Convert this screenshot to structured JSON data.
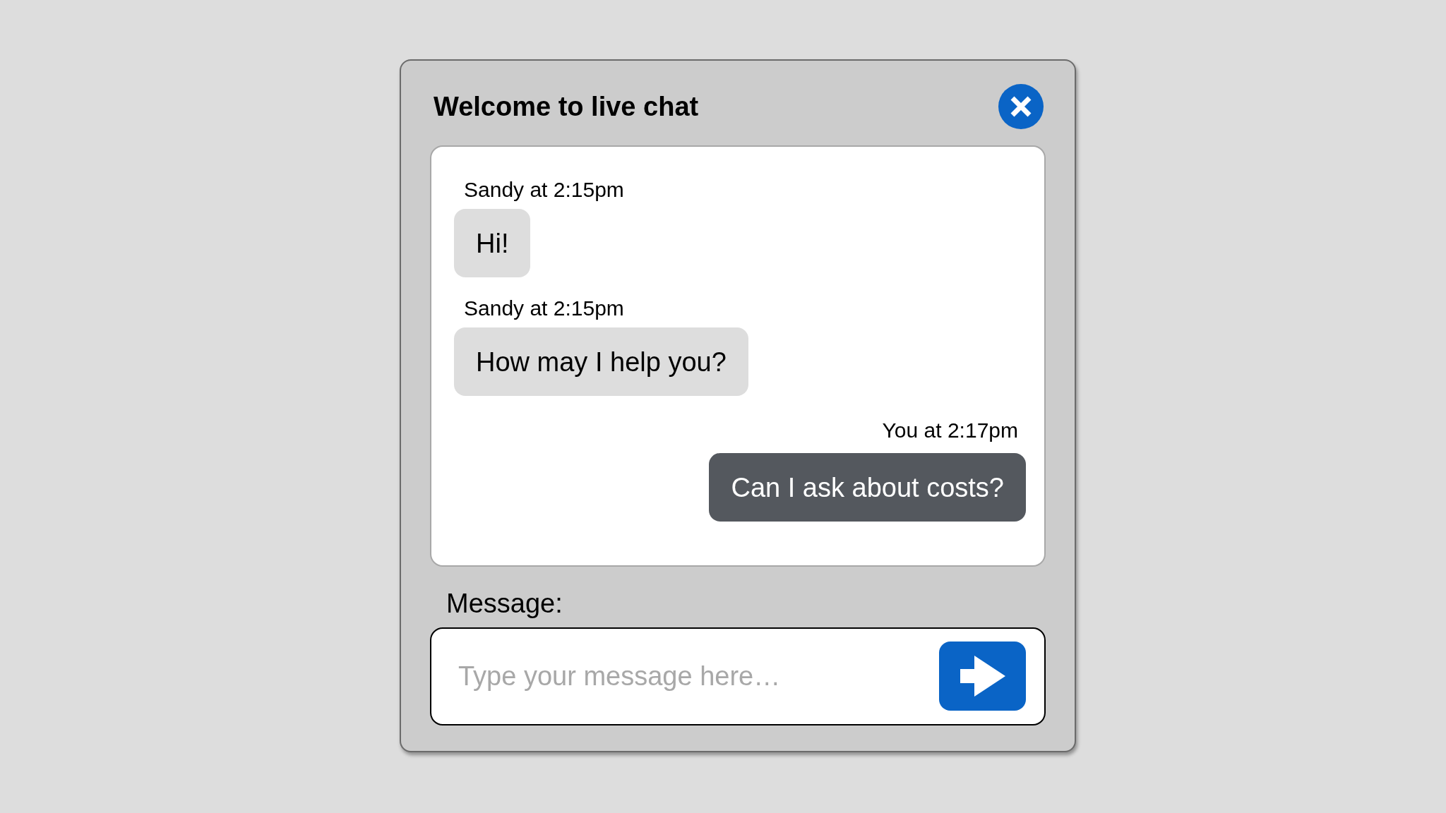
{
  "window": {
    "title": "Welcome to live chat"
  },
  "messages": [
    {
      "kind": "received",
      "meta": "Sandy at 2:15pm",
      "text": "Hi!"
    },
    {
      "kind": "received",
      "meta": "Sandy at 2:15pm",
      "text": "How may I help you?"
    },
    {
      "kind": "sent",
      "meta": "You at 2:17pm",
      "text": "Can I ask about costs?"
    }
  ],
  "composer": {
    "label": "Message:",
    "placeholder": "Type your message here…"
  }
}
